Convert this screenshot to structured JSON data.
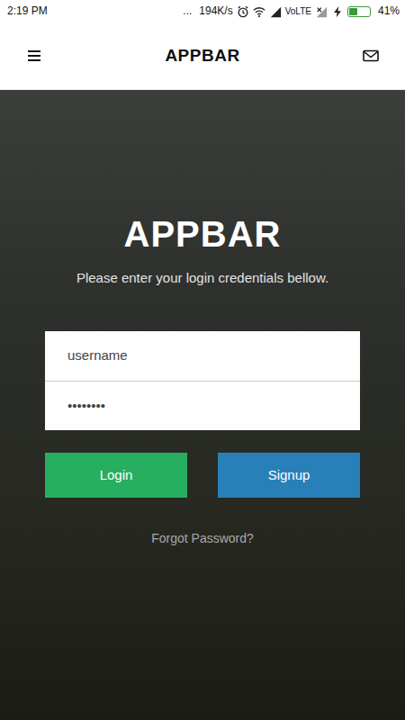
{
  "status_bar": {
    "time": "2:19 PM",
    "notifications": "...",
    "speed": "194K/s",
    "network": "VoLTE",
    "battery": "41%",
    "battery_level": 0.41,
    "charging": true
  },
  "app_bar": {
    "title": "APPBAR"
  },
  "login": {
    "title": "APPBAR",
    "subtitle": "Please enter your login credentials bellow.",
    "username": {
      "value": "username"
    },
    "password": {
      "value": "••••••••"
    },
    "buttons": [
      {
        "label": "Login",
        "color": "#27ae60"
      },
      {
        "label": "Signup",
        "color": "#2980b9"
      }
    ],
    "forgot": "Forgot Password?"
  }
}
